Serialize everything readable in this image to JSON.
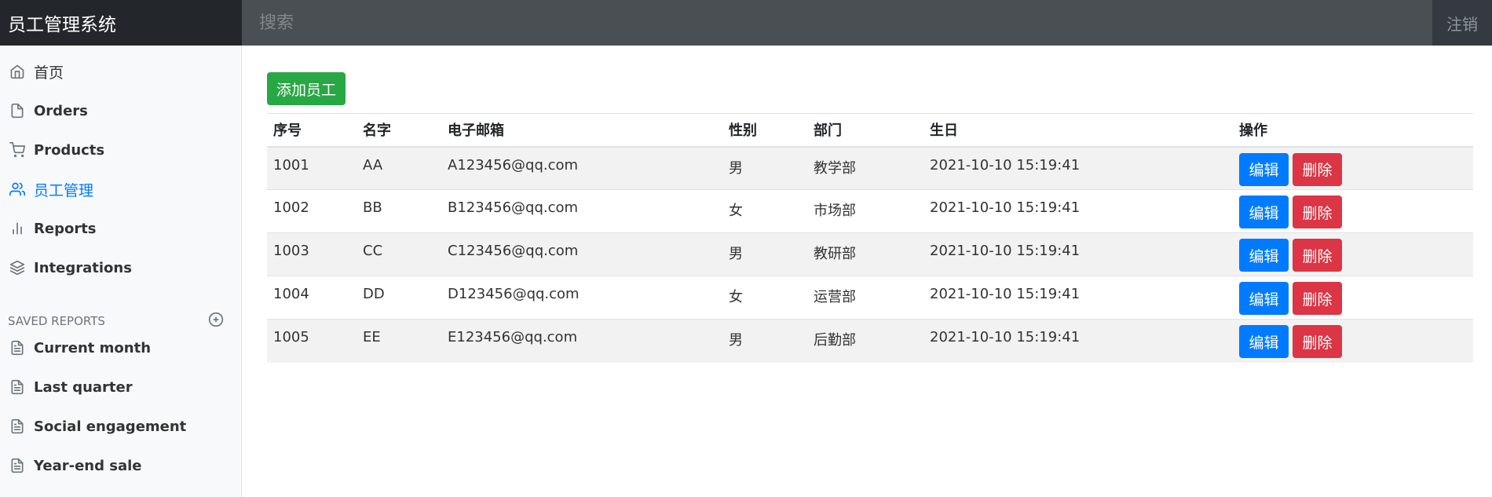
{
  "app": {
    "brand": "员工管理系统",
    "search_placeholder": "搜索",
    "logout_label": "注销"
  },
  "sidebar": {
    "items": [
      {
        "label": "首页",
        "icon": "home-icon"
      },
      {
        "label": "Orders",
        "icon": "file-icon"
      },
      {
        "label": "Products",
        "icon": "cart-icon"
      },
      {
        "label": "员工管理",
        "icon": "users-icon",
        "active": true
      },
      {
        "label": "Reports",
        "icon": "bar-chart-icon"
      },
      {
        "label": "Integrations",
        "icon": "layers-icon"
      }
    ],
    "saved_heading": "SAVED REPORTS",
    "saved": [
      {
        "label": "Current month",
        "icon": "file-text-icon"
      },
      {
        "label": "Last quarter",
        "icon": "file-text-icon"
      },
      {
        "label": "Social engagement",
        "icon": "file-text-icon"
      },
      {
        "label": "Year-end sale",
        "icon": "file-text-icon"
      }
    ]
  },
  "main": {
    "add_button": "添加员工",
    "columns": [
      "序号",
      "名字",
      "电子邮箱",
      "性别",
      "部门",
      "生日",
      "操作"
    ],
    "rows": [
      {
        "id": "1001",
        "name": "AA",
        "email": "A123456@qq.com",
        "gender": "男",
        "dept": "教学部",
        "birth": "2021-10-10 15:19:41"
      },
      {
        "id": "1002",
        "name": "BB",
        "email": "B123456@qq.com",
        "gender": "女",
        "dept": "市场部",
        "birth": "2021-10-10 15:19:41"
      },
      {
        "id": "1003",
        "name": "CC",
        "email": "C123456@qq.com",
        "gender": "男",
        "dept": "教研部",
        "birth": "2021-10-10 15:19:41"
      },
      {
        "id": "1004",
        "name": "DD",
        "email": "D123456@qq.com",
        "gender": "女",
        "dept": "运营部",
        "birth": "2021-10-10 15:19:41"
      },
      {
        "id": "1005",
        "name": "EE",
        "email": "E123456@qq.com",
        "gender": "男",
        "dept": "后勤部",
        "birth": "2021-10-10 15:19:41"
      }
    ],
    "edit_label": "编辑",
    "delete_label": "删除"
  },
  "colors": {
    "accent": "#007bff",
    "success": "#28a745",
    "danger": "#dc3545",
    "navbar": "#343a40"
  }
}
